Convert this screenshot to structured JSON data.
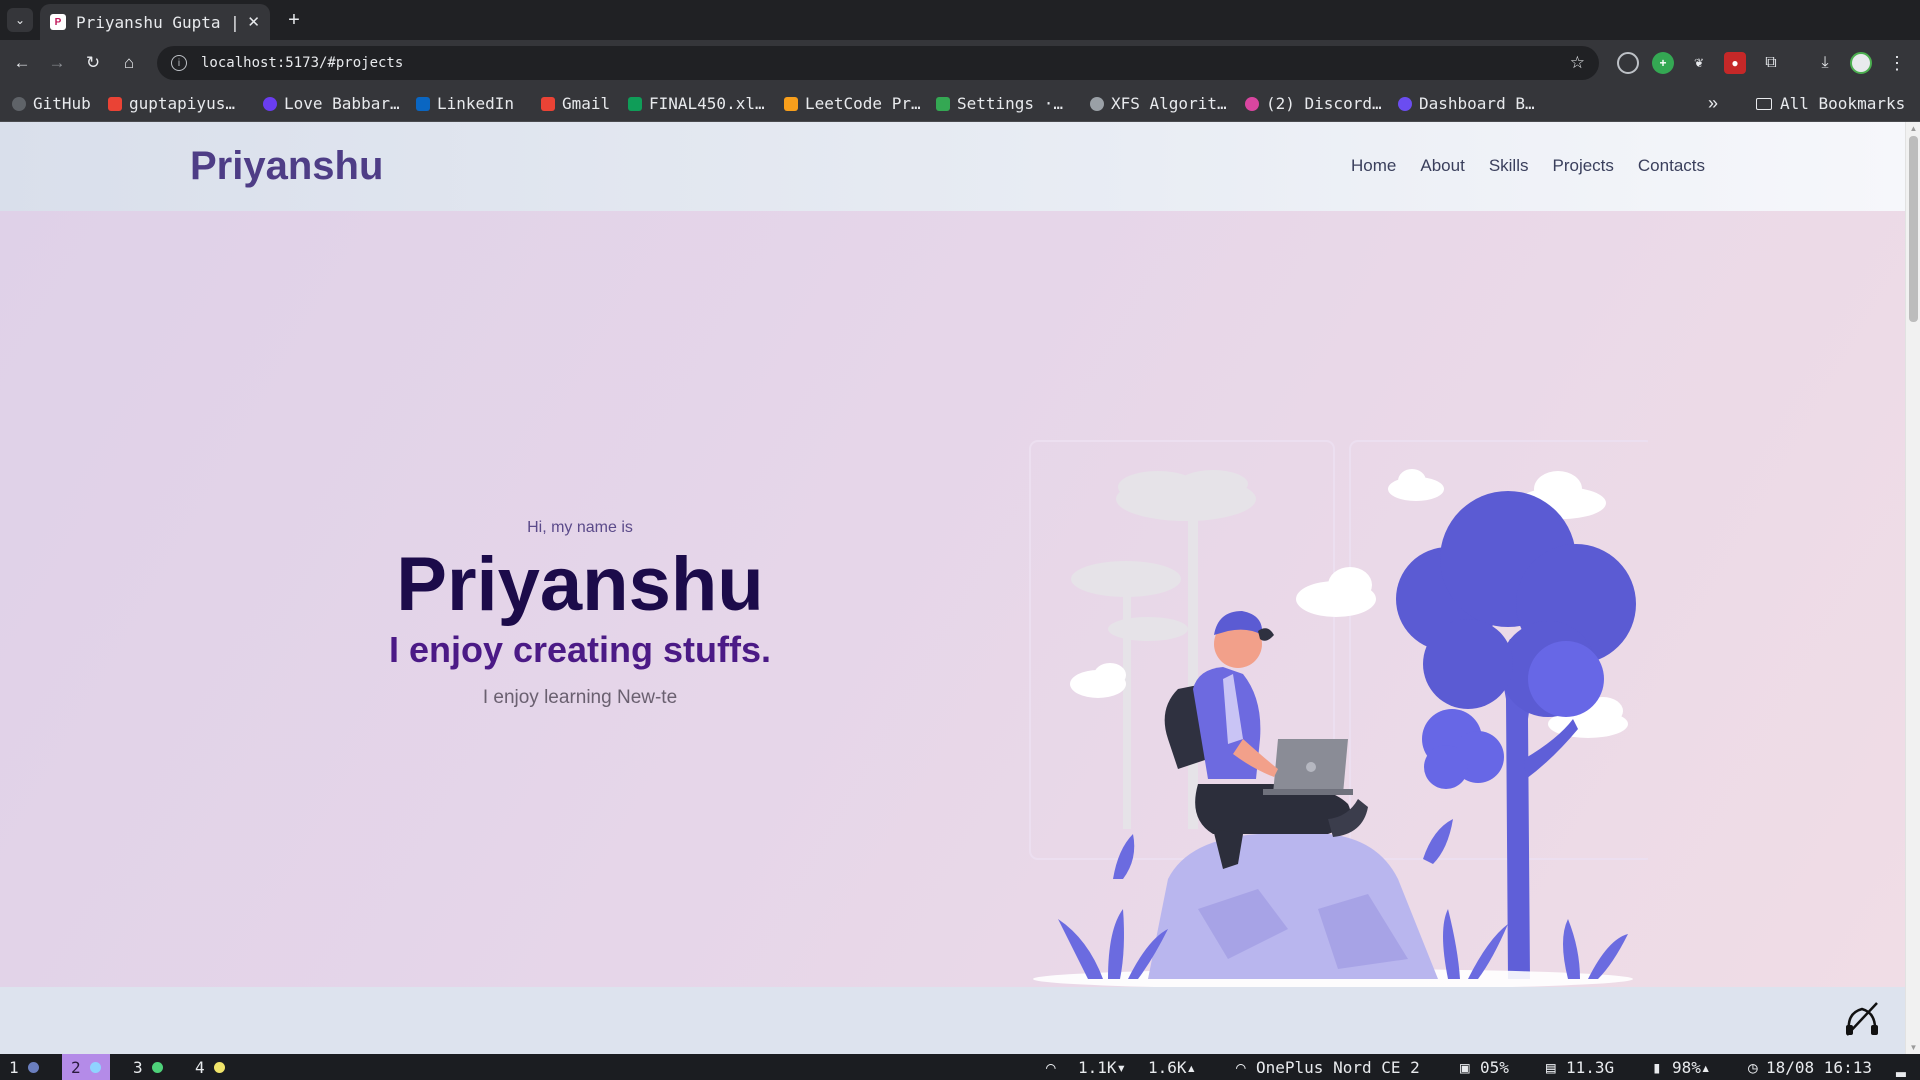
{
  "browser": {
    "tab_title": "Priyanshu Gupta |",
    "tab_close": "✕",
    "new_tab": "+",
    "url": "localhost:5173/#projects",
    "bookmarks": [
      {
        "label": "GitHub",
        "color": "#2b2b2b"
      },
      {
        "label": "guptapiyus…",
        "color": "#ea4335"
      },
      {
        "label": "Love Babbar…",
        "color": "#6a3df0"
      },
      {
        "label": "LinkedIn",
        "color": "#0a66c2"
      },
      {
        "label": "Gmail",
        "color": "#ea4335"
      },
      {
        "label": "FINAL450.xl…",
        "color": "#0f9d58"
      },
      {
        "label": "LeetCode Pr…",
        "color": "#f89f1b"
      },
      {
        "label": "Settings ·…",
        "color": "#34a853"
      },
      {
        "label": "XFS Algorit…",
        "color": "#9aa0a6"
      },
      {
        "label": "(2) Discord…",
        "color": "#d946a0"
      },
      {
        "label": "Dashboard B…",
        "color": "#6b4df0"
      }
    ],
    "bookmarks_overflow": "»",
    "all_bookmarks": "All Bookmarks"
  },
  "site": {
    "logo": "Priyanshu",
    "nav": [
      "Home",
      "About",
      "Skills",
      "Projects",
      "Contacts"
    ],
    "hero": {
      "greeting": "Hi, my name is",
      "name": "Priyanshu",
      "tagline": "I enjoy creating stuffs.",
      "typing_line": "I enjoy learning New-te"
    }
  },
  "statusbar": {
    "workspaces": [
      {
        "num": "1",
        "dot": "#6b7fbf",
        "active": false
      },
      {
        "num": "2",
        "dot": "#8fd3ff",
        "active": true
      },
      {
        "num": "3",
        "dot": "#4ed27a",
        "active": false
      },
      {
        "num": "4",
        "dot": "#f0e46a",
        "active": false
      }
    ],
    "net_down": "1.1K▾",
    "net_up": "1.6K▴",
    "wifi": "OnePlus Nord CE 2",
    "cpu": "05%",
    "memory": "11.3G",
    "battery": "98%▴",
    "datetime": "18/08 16:13"
  },
  "colors": {
    "accent": "#5b5bd6",
    "logo": "#4e3d86",
    "name": "#1c0b4a",
    "tagline": "#4b1a86"
  }
}
